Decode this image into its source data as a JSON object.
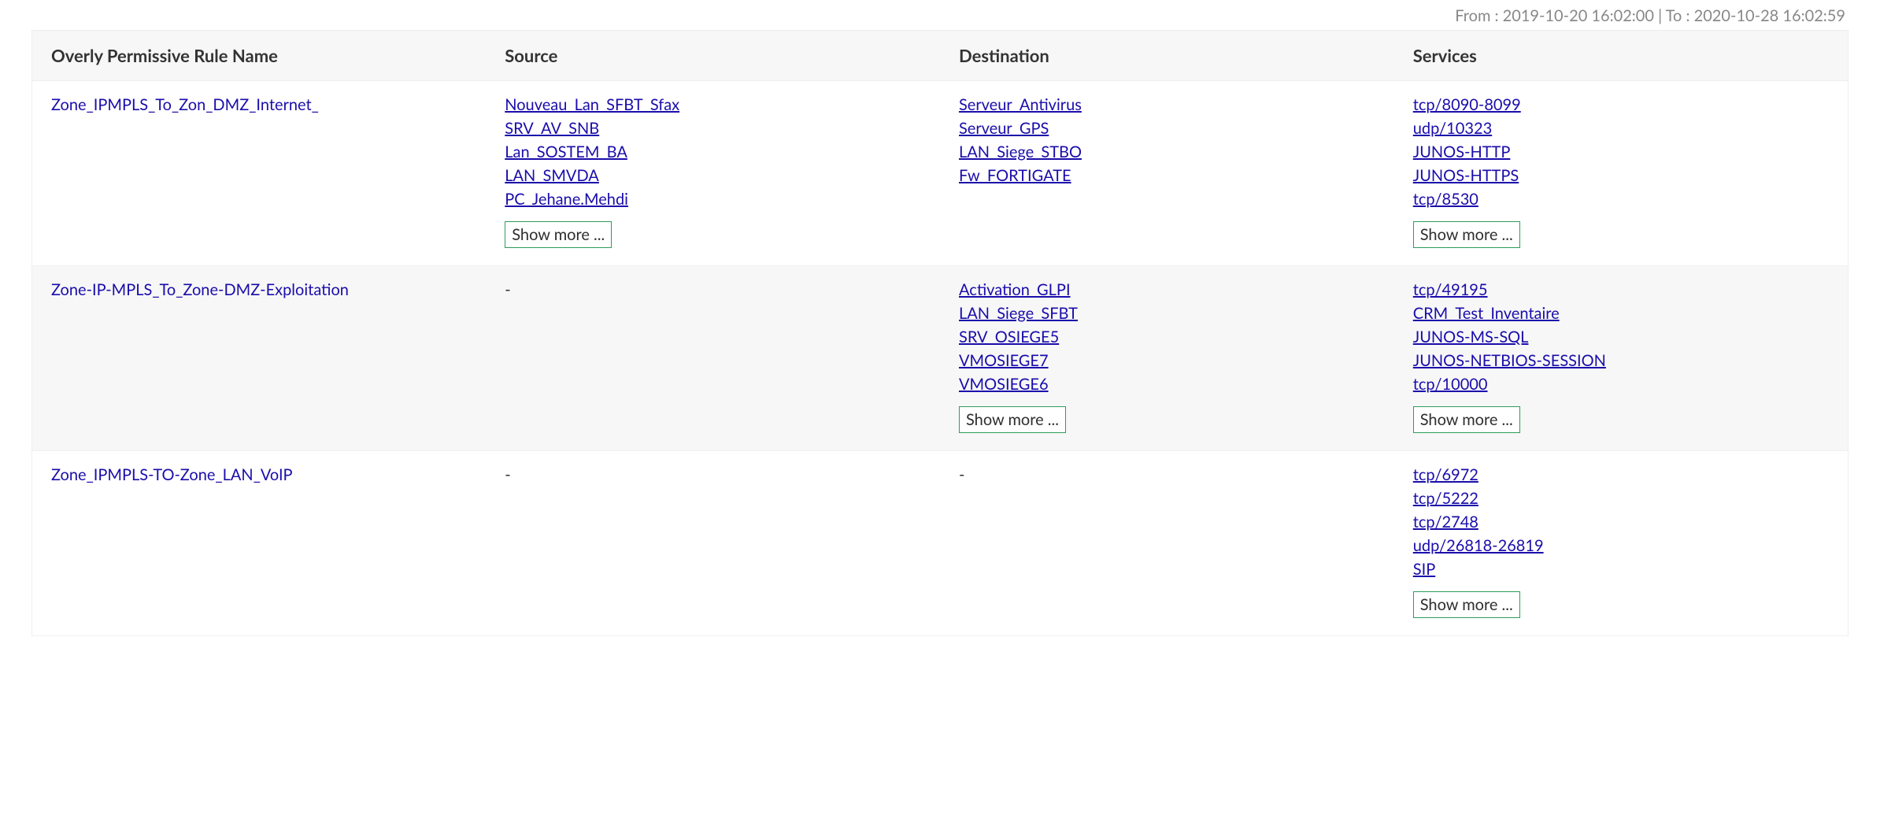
{
  "date_range": "From : 2019-10-20 16:02:00 | To : 2020-10-28 16:02:59",
  "headers": {
    "rule": "Overly Permissive Rule Name",
    "source": "Source",
    "dest": "Destination",
    "serv": "Services"
  },
  "show_more_label": "Show more ...",
  "rows": [
    {
      "rule": "Zone_IPMPLS_To_Zon_DMZ_Internet_",
      "source": [
        "Nouveau_Lan_SFBT_Sfax",
        "SRV_AV_SNB",
        "Lan_SOSTEM_BA",
        "LAN_SMVDA",
        "PC_Jehane.Mehdi"
      ],
      "source_more": true,
      "dest": [
        "Serveur_Antivirus",
        "Serveur_GPS",
        "LAN_Siege_STBO",
        "Fw_FORTIGATE"
      ],
      "dest_more": false,
      "serv": [
        "tcp/8090-8099",
        "udp/10323",
        "JUNOS-HTTP",
        "JUNOS-HTTPS",
        "tcp/8530"
      ],
      "serv_more": true
    },
    {
      "rule": "Zone-IP-MPLS_To_Zone-DMZ-Exploitation",
      "source": [],
      "source_more": false,
      "dest": [
        "Activation_GLPI",
        "LAN_Siege_SFBT",
        "SRV_OSIEGE5",
        "VMOSIEGE7",
        "VMOSIEGE6"
      ],
      "dest_more": true,
      "serv": [
        "tcp/49195",
        "CRM_Test_Inventaire",
        "JUNOS-MS-SQL",
        "JUNOS-NETBIOS-SESSION",
        "tcp/10000"
      ],
      "serv_more": true
    },
    {
      "rule": "Zone_IPMPLS-TO-Zone_LAN_VoIP",
      "source": [],
      "source_more": false,
      "dest": [],
      "dest_more": false,
      "serv": [
        "tcp/6972",
        "tcp/5222",
        "tcp/2748",
        "udp/26818-26819",
        "SIP"
      ],
      "serv_more": true
    }
  ]
}
